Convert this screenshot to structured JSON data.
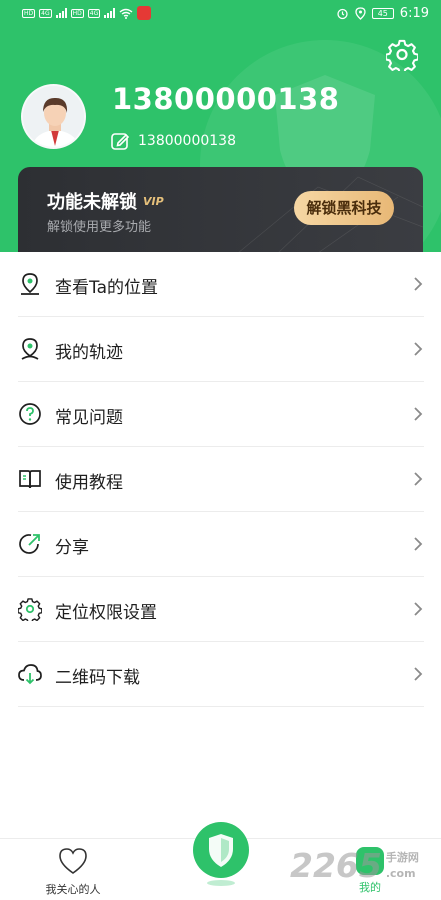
{
  "status_bar": {
    "left": [
      "HD",
      "4G",
      "HD",
      "4G",
      "WiFi"
    ],
    "battery": "45",
    "time": "6:19"
  },
  "header": {
    "phone": "13800000138",
    "sub_phone": "13800000138"
  },
  "vip_card": {
    "title": "功能未解锁",
    "badge": "VIP",
    "subtitle": "解锁使用更多功能",
    "button": "解锁黑科技"
  },
  "menu": {
    "items": [
      {
        "label": "查看Ta的位置",
        "icon": "location-pin-icon"
      },
      {
        "label": "我的轨迹",
        "icon": "track-icon"
      },
      {
        "label": "常见问题",
        "icon": "question-icon"
      },
      {
        "label": "使用教程",
        "icon": "book-icon"
      },
      {
        "label": "分享",
        "icon": "share-icon"
      },
      {
        "label": "定位权限设置",
        "icon": "gear-icon"
      },
      {
        "label": "二维码下载",
        "icon": "cloud-download-icon"
      }
    ]
  },
  "bottom_nav": {
    "left_label": "我关心的人",
    "right_label": "我的"
  },
  "watermark": {
    "number": "2265",
    "line1": "手游网",
    "line2": ".com"
  },
  "colors": {
    "brand_green": "#2ec26a",
    "vip_gold": "#e8b876",
    "card_dark": "#2d2f33"
  }
}
